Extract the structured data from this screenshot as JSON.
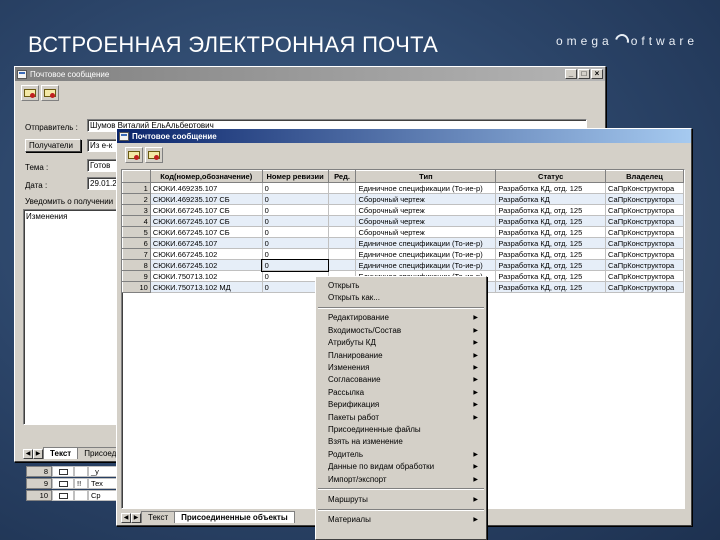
{
  "slide": {
    "title": "ВСТРОЕННАЯ ЭЛЕКТРОННАЯ ПОЧТА",
    "logo": "omega software",
    "logo_left": "omega",
    "logo_right": "oftware"
  },
  "back_window": {
    "title": "Почтовое сообщение",
    "sender_label": "Отправитель :",
    "sender_value": "Шумов Виталий ЕльАльбертович",
    "recipients_button": "Получатели",
    "recipients_value": "Из е-к",
    "subject_label": "Тема :",
    "subject_value": "Готов",
    "date_label": "Дата :",
    "date_value": "29.01.2",
    "notice_text": "Уведомить о получении",
    "body_text": "Изменения",
    "tabs": [
      "Текст",
      "Присоед"
    ],
    "under_rows": [
      {
        "num": "8",
        "c1": "",
        "c2": "_у"
      },
      {
        "num": "9",
        "c1": "!!",
        "c2": "Тех"
      },
      {
        "num": "10",
        "c1": "",
        "c2": "Ср"
      }
    ]
  },
  "front_window": {
    "title": "Почтовое сообщение",
    "columns": [
      "Код(номер,обозначение)",
      "Номер ревизии",
      "Ред.",
      "Тип",
      "Статус",
      "Владелец"
    ],
    "rows": [
      {
        "num": "1",
        "code": "СЮКИ.469235.107",
        "rev": "0",
        "red": "",
        "type": "Единичное спецификации (То-ие-р)",
        "status": "Разработка КД, отд. 125",
        "owner": "СаПрКонструктора"
      },
      {
        "num": "2",
        "code": "СЮКИ.469235.107 СБ",
        "rev": "0",
        "red": "",
        "type": "Сборочный чертеж",
        "status": "Разработка КД",
        "owner": "СаПрКонструктора"
      },
      {
        "num": "3",
        "code": "СЮКИ.667245.107 СБ",
        "rev": "0",
        "red": "",
        "type": "Сборочный чертеж",
        "status": "Разработка КД, отд. 125",
        "owner": "СаПрКонструктора"
      },
      {
        "num": "4",
        "code": "СЮКИ.667245.107 СБ",
        "rev": "0",
        "red": "",
        "type": "Сборочный чертеж",
        "status": "Разработка КД, отд. 125",
        "owner": "СаПрКонструктора"
      },
      {
        "num": "5",
        "code": "СЮКИ.667245.107 СБ",
        "rev": "0",
        "red": "",
        "type": "Сборочный чертеж",
        "status": "Разработка КД, отд. 125",
        "owner": "СаПрКонструктора"
      },
      {
        "num": "6",
        "code": "СЮКИ.667245.107",
        "rev": "0",
        "red": "",
        "type": "Единичное спецификации (То-ие-р)",
        "status": "Разработка КД, отд. 125",
        "owner": "СаПрКонструктора"
      },
      {
        "num": "7",
        "code": "СЮКИ.667245.102",
        "rev": "0",
        "red": "",
        "type": "Единичное спецификации (То-ие-р)",
        "status": "Разработка КД, отд. 125",
        "owner": "СаПрКонструктора"
      },
      {
        "num": "8",
        "code": "СЮКИ.667245.102",
        "rev": "0",
        "red": "",
        "type": "Единичное спецификации (То-ие-р)",
        "status": "Разработка КД, отд. 125",
        "owner": "СаПрКонструктора"
      },
      {
        "num": "9",
        "code": "СЮКИ.750713.102",
        "rev": "0",
        "red": "",
        "type": "Единичное спецификации (То-ие-р)",
        "status": "Разработка КД, отд. 125",
        "owner": "СаПрКонструктора"
      },
      {
        "num": "10",
        "code": "СЮКИ.750713.102 МД",
        "rev": "0",
        "red": "",
        "type": "Единичное спецификации (То-ие-р)",
        "status": "Разработка КД, отд. 125",
        "owner": "СаПрКонструктора"
      }
    ],
    "tabs": [
      "Текст",
      "Присоединенные объекты"
    ]
  },
  "context_menu": {
    "groups": [
      [
        {
          "label": "Открыть",
          "submenu": false
        },
        {
          "label": "Открыть как...",
          "submenu": false
        }
      ],
      [
        {
          "label": "Редактирование",
          "submenu": true
        },
        {
          "label": "Входимость/Состав",
          "submenu": true
        },
        {
          "label": "Атрибуты КД",
          "submenu": true
        },
        {
          "label": "Планирование",
          "submenu": true
        },
        {
          "label": "Изменения",
          "submenu": true
        },
        {
          "label": "Согласование",
          "submenu": true
        },
        {
          "label": "Рассылка",
          "submenu": true
        },
        {
          "label": "Верификация",
          "submenu": true
        },
        {
          "label": "Пакеты работ",
          "submenu": true
        },
        {
          "label": "Присоединенные файлы",
          "submenu": false
        },
        {
          "label": "Взять на изменение",
          "submenu": false
        },
        {
          "label": "Родитель",
          "submenu": true
        },
        {
          "label": "Данные по видам обработки",
          "submenu": true
        },
        {
          "label": "Импорт/экспорт",
          "submenu": true
        }
      ],
      [
        {
          "label": "Маршруты",
          "submenu": true
        }
      ],
      [
        {
          "label": "Материалы",
          "submenu": true
        }
      ]
    ]
  },
  "colors": {
    "background": "#2b4468",
    "active_title": "#0a246a",
    "row_alt": "#e6eef8",
    "window_face": "#d4d0c8"
  }
}
